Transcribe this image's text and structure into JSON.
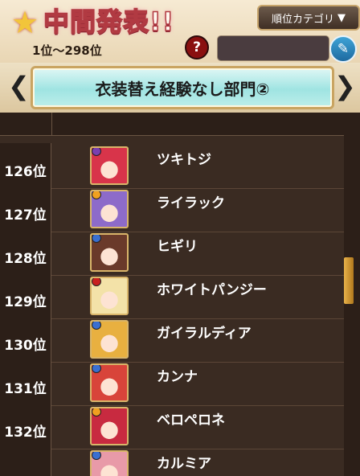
{
  "header": {
    "title": "中間発表!!",
    "range": "1位～298位",
    "category_button": "順位カテゴリ",
    "category_arrow": "▼",
    "help_label": "?",
    "search_value": ""
  },
  "category": {
    "label": "衣装替え経験なし部門②",
    "prev": "❮",
    "next": "❯"
  },
  "rows": [
    {
      "rank": "126位",
      "name": "ツキトジ",
      "orb": "#7a3fb0",
      "hair": "#d8344a"
    },
    {
      "rank": "127位",
      "name": "ライラック",
      "orb": "#f0a020",
      "hair": "#8d6bc9"
    },
    {
      "rank": "128位",
      "name": "ヒギリ",
      "orb": "#3a6fd0",
      "hair": "#6a3a2a"
    },
    {
      "rank": "129位",
      "name": "ホワイトパンジー",
      "orb": "#c8201e",
      "hair": "#f3e2a8"
    },
    {
      "rank": "130位",
      "name": "ガイラルディア",
      "orb": "#3a6fd0",
      "hair": "#e8b040"
    },
    {
      "rank": "131位",
      "name": "カンナ",
      "orb": "#3a6fd0",
      "hair": "#d8443a"
    },
    {
      "rank": "132位",
      "name": "ベロペロネ",
      "orb": "#f0a020",
      "hair": "#c82a40"
    },
    {
      "rank": "",
      "name": "カルミア",
      "orb": "#3a6fd0",
      "hair": "#e89aa8"
    }
  ]
}
